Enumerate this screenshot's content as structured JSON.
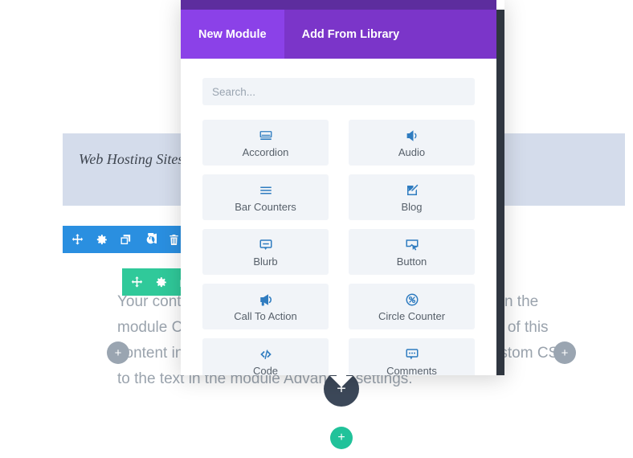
{
  "canvas": {
    "quote": {
      "text": "Web Hosting Sites may be compensated through referral links on our site."
    },
    "body": {
      "text": "Your content goes here. Edit or remove this text inline or in the module Content settings. You can also style every aspect of this content in the module Design settings and even apply custom CSS to the text in the module Advanced settings."
    },
    "toolbars": [
      {
        "name": "blue-module-toolbar",
        "color": "#2a8fe0",
        "icons": [
          "move-icon",
          "gear-icon",
          "duplicate-icon",
          "disable-icon",
          "trash-icon"
        ]
      },
      {
        "name": "teal-module-toolbar",
        "color": "#30c99a",
        "icons": [
          "move-icon",
          "gear-icon",
          "duplicate-icon"
        ]
      }
    ],
    "add_buttons": [
      {
        "name": "add-row-left",
        "label": "+",
        "color": "#9aa5b1"
      },
      {
        "name": "add-row-right",
        "label": "+",
        "color": "#9aa5b1"
      },
      {
        "name": "add-section",
        "label": "+",
        "color": "#3c4859"
      },
      {
        "name": "add-module",
        "label": "+",
        "color": "#21c29a"
      }
    ]
  },
  "modal": {
    "accent_color": "#8b41e8",
    "header_color": "#7b35c9",
    "tabs": [
      {
        "label": "New Module",
        "active": true
      },
      {
        "label": "Add From Library",
        "active": false
      }
    ],
    "search": {
      "value": "",
      "placeholder": "Search..."
    },
    "modules": [
      {
        "label": "Accordion",
        "icon": "accordion-icon"
      },
      {
        "label": "Audio",
        "icon": "audio-icon"
      },
      {
        "label": "Bar Counters",
        "icon": "bar-counters-icon"
      },
      {
        "label": "Blog",
        "icon": "blog-icon"
      },
      {
        "label": "Blurb",
        "icon": "blurb-icon"
      },
      {
        "label": "Button",
        "icon": "button-icon"
      },
      {
        "label": "Call To Action",
        "icon": "call-to-action-icon"
      },
      {
        "label": "Circle Counter",
        "icon": "circle-counter-icon"
      },
      {
        "label": "Code",
        "icon": "code-icon"
      },
      {
        "label": "Comments",
        "icon": "comments-icon"
      }
    ]
  }
}
